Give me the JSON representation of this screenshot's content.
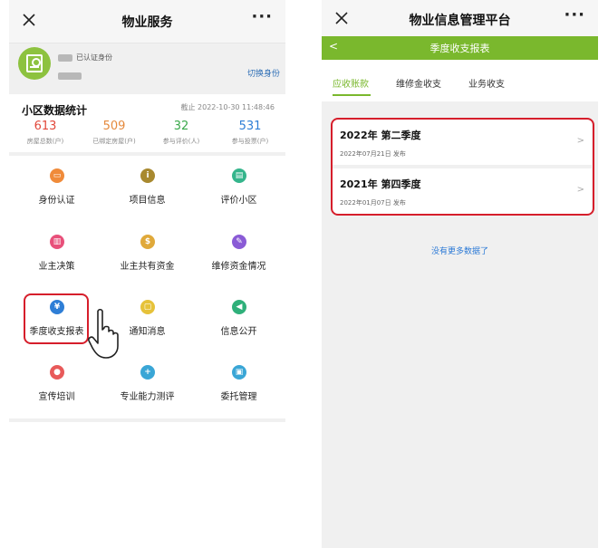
{
  "left": {
    "title": "物业服务",
    "more": "···",
    "profile": {
      "verified": "已认证身份",
      "switch": "切换身份"
    },
    "stats": {
      "title": "小区数据统计",
      "cutoff": "截止 2022-10-30 11:48:46",
      "items": [
        {
          "value": "613",
          "label": "房屋总数(户)",
          "color": "#e2483b"
        },
        {
          "value": "509",
          "label": "已绑定房屋(户)",
          "color": "#e58a3d"
        },
        {
          "value": "32",
          "label": "参与评价(人)",
          "color": "#39a84a"
        },
        {
          "value": "531",
          "label": "参与投票(户)",
          "color": "#2e7ed6"
        }
      ]
    },
    "grid": [
      {
        "label": "身份认证",
        "icon": "id-card-icon",
        "glyph": "▭",
        "color": "#f08b3a"
      },
      {
        "label": "项目信息",
        "icon": "info-icon",
        "glyph": "i",
        "color": "#a8892f"
      },
      {
        "label": "评价小区",
        "icon": "comment-icon",
        "glyph": "▤",
        "color": "#35b58c"
      },
      {
        "label": "业主决策",
        "icon": "chart-icon",
        "glyph": "▥",
        "color": "#e8507a"
      },
      {
        "label": "业主共有资金",
        "icon": "money-icon",
        "glyph": "$",
        "color": "#e0a93a"
      },
      {
        "label": "维修资金情况",
        "icon": "wrench-icon",
        "glyph": "✎",
        "color": "#8a5bd6"
      },
      {
        "label": "季度收支报表",
        "icon": "yen-icon",
        "glyph": "¥",
        "color": "#2e7ed6"
      },
      {
        "label": "通知消息",
        "icon": "message-icon",
        "glyph": "▢",
        "color": "#e6c23a"
      },
      {
        "label": "信息公开",
        "icon": "megaphone-icon",
        "glyph": "◀",
        "color": "#2fb07a"
      },
      {
        "label": "宣传培训",
        "icon": "people-icon",
        "glyph": "●",
        "color": "#e85a5a"
      },
      {
        "label": "专业能力测评",
        "icon": "medkit-icon",
        "glyph": "+",
        "color": "#3aa6d6"
      },
      {
        "label": "委托管理",
        "icon": "delegate-icon",
        "glyph": "▣",
        "color": "#3aa6d6"
      }
    ]
  },
  "right": {
    "title": "物业信息管理平台",
    "more": "···",
    "header": "季度收支报表",
    "back": "<",
    "tabs": [
      "应收账款",
      "维修金收支",
      "业务收支"
    ],
    "reports": [
      {
        "title": "2022年 第二季度",
        "date": "2022年07月21日 发布"
      },
      {
        "title": "2021年 第四季度",
        "date": "2022年01月07日 发布"
      }
    ],
    "no_more": "没有更多数据了"
  }
}
